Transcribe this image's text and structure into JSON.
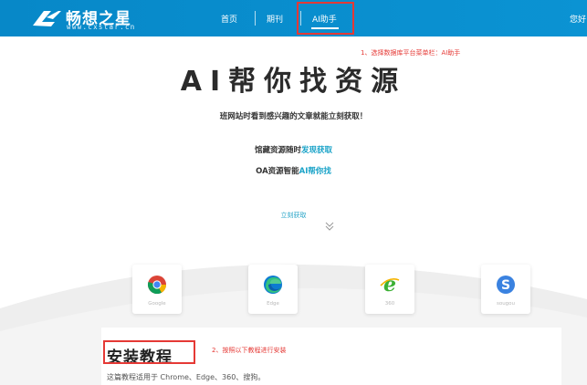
{
  "header": {
    "logo_cn": "畅想之星",
    "logo_en": "www.cxstar.cn",
    "nav": [
      "首页",
      "期刊",
      "AI助手"
    ],
    "active_nav": "AI助手",
    "user_text": "您好"
  },
  "annotations": {
    "step1": "1、选择数据库平台菜单栏：AI助手",
    "step2": "2、按照以下教程进行安装"
  },
  "hero": {
    "title": "AI帮你找资源",
    "subtitle": "班网站时看到感兴趣的文章就能立刻获取！",
    "line1_prefix": "馆藏资源随时",
    "line1_accent": "发现获取",
    "line2_prefix": "OA资源智能",
    "line2_accent": "AI帮你找",
    "get_now": "立刻获取"
  },
  "browsers": [
    {
      "name": "Google",
      "icon": "chrome-icon"
    },
    {
      "name": "Edge",
      "icon": "edge-icon"
    },
    {
      "name": "360",
      "icon": "ie-360-icon"
    },
    {
      "name": "sougou",
      "icon": "sogou-icon"
    }
  ],
  "tutorial": {
    "title": "安装教程",
    "description": "这篇教程适用于 Chrome、Edge、360、搜狗。"
  },
  "colors": {
    "header_bg": "#0a8fcf",
    "accent": "#1aa3c8",
    "annotation_red": "#e53935"
  }
}
